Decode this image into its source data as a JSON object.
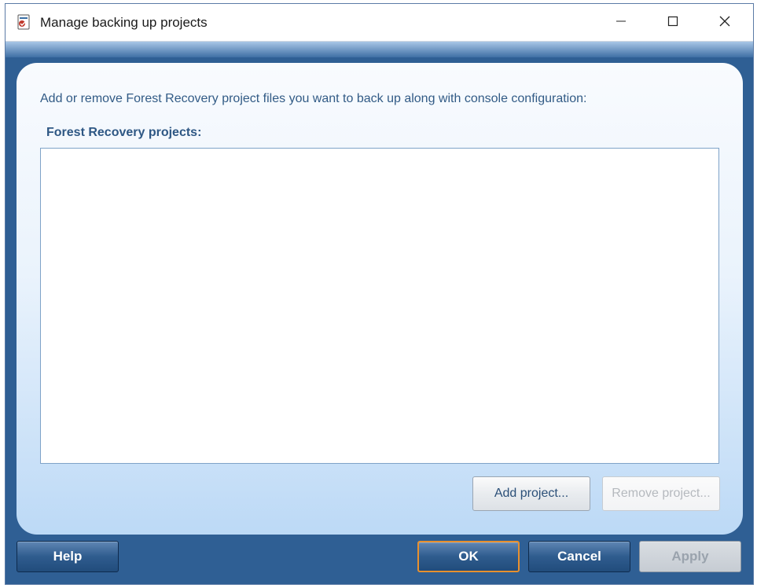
{
  "window": {
    "title": "Manage backing up projects",
    "icon": "app-icon",
    "controls": [
      "minimize-icon",
      "maximize-icon",
      "close-icon"
    ]
  },
  "content": {
    "instructions": "Add or remove Forest Recovery project files you want to back up along with console configuration:",
    "list_label": "Forest Recovery projects:",
    "projects": [],
    "add_label": "Add project...",
    "remove_label": "Remove project..."
  },
  "footer": {
    "help_label": "Help",
    "ok_label": "OK",
    "cancel_label": "Cancel",
    "apply_label": "Apply"
  },
  "colors": {
    "frame": "#2f5f94",
    "accent_focus": "#e8902e",
    "label_text": "#2e5784"
  }
}
